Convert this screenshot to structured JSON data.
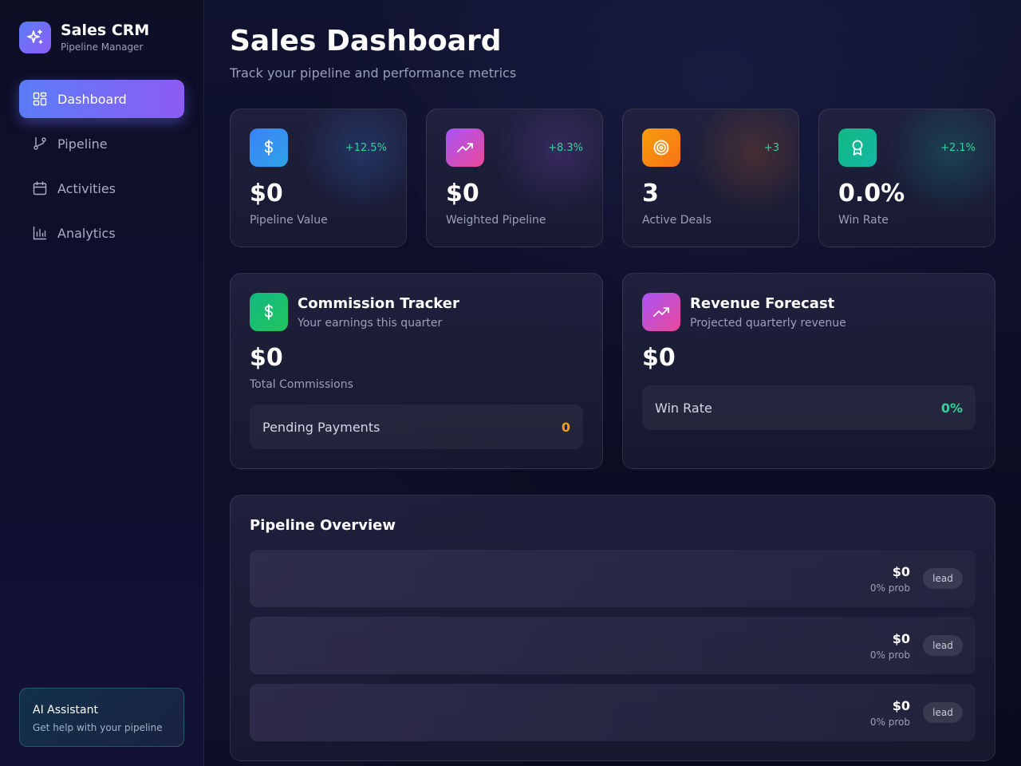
{
  "brand": {
    "title": "Sales CRM",
    "subtitle": "Pipeline Manager",
    "icon": "sparkles-icon"
  },
  "nav": {
    "items": [
      {
        "label": "Dashboard",
        "icon": "grid-icon",
        "active": true
      },
      {
        "label": "Pipeline",
        "icon": "git-branch-icon",
        "active": false
      },
      {
        "label": "Activities",
        "icon": "calendar-icon",
        "active": false
      },
      {
        "label": "Analytics",
        "icon": "bar-chart-icon",
        "active": false
      }
    ]
  },
  "ai_assistant": {
    "title": "AI Assistant",
    "subtitle": "Get help with your pipeline"
  },
  "header": {
    "title": "Sales Dashboard",
    "subtitle": "Track your pipeline and performance metrics"
  },
  "stats": [
    {
      "value": "$0",
      "label": "Pipeline Value",
      "change": "+12.5%",
      "icon": "dollar-icon",
      "color": "#3b82f6"
    },
    {
      "value": "$0",
      "label": "Weighted Pipeline",
      "change": "+8.3%",
      "icon": "trending-up-icon",
      "color": "#c94fd8"
    },
    {
      "value": "3",
      "label": "Active Deals",
      "change": "+3",
      "icon": "target-icon",
      "color": "#f97316"
    },
    {
      "value": "0.0%",
      "label": "Win Rate",
      "change": "+2.1%",
      "icon": "award-icon",
      "color": "#14b8a6"
    }
  ],
  "commission": {
    "title": "Commission Tracker",
    "subtitle": "Your earnings this quarter",
    "value": "$0",
    "value_label": "Total Commissions",
    "pending_label": "Pending Payments",
    "pending_value": "0",
    "pending_color": "#f59e0b"
  },
  "forecast": {
    "title": "Revenue Forecast",
    "subtitle": "Projected quarterly revenue",
    "value": "$0",
    "winrate_label": "Win Rate",
    "winrate_value": "0%",
    "winrate_color": "#34d399"
  },
  "pipeline": {
    "title": "Pipeline Overview",
    "rows": [
      {
        "amount": "$0",
        "prob": "0% prob",
        "stage": "lead"
      },
      {
        "amount": "$0",
        "prob": "0% prob",
        "stage": "lead"
      },
      {
        "amount": "$0",
        "prob": "0% prob",
        "stage": "lead"
      }
    ]
  }
}
